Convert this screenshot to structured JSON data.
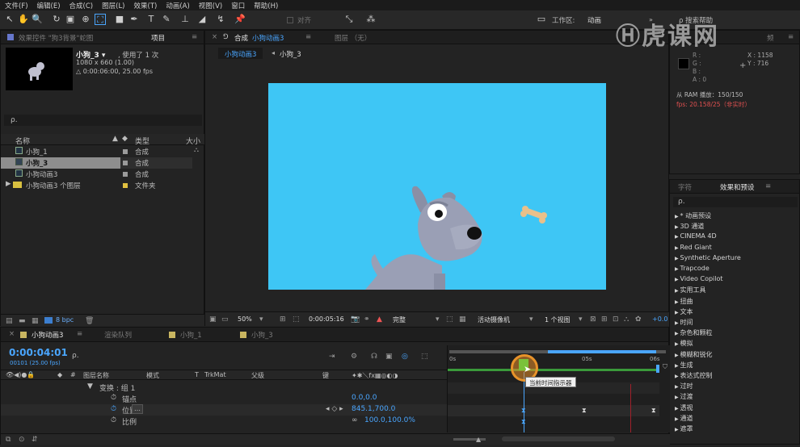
{
  "menu": [
    "文件(F)",
    "编辑(E)",
    "合成(C)",
    "图层(L)",
    "效果(T)",
    "动画(A)",
    "视图(V)",
    "窗口",
    "帮助(H)"
  ],
  "toolbar": {
    "align_label": "对齐",
    "workspace_label": "工作区:",
    "workspace_value": "动画",
    "search_help": "搜索帮助"
  },
  "project_panel": {
    "tab_effects": "效果控件 \"狗3背景\"蛇图",
    "tab_project": "项目",
    "comp_name": "小狗_3 ▾",
    "used_label": ", 使用了 1 次",
    "dimensions": "1080 x 660 (1.00)",
    "duration": "△ 0:00:06:00, 25.00 fps",
    "search_placeholder": "ρ.",
    "col_name": "名称",
    "col_type": "类型",
    "col_size": "大小",
    "items": [
      {
        "name": "小狗_1",
        "type": "合成"
      },
      {
        "name": "小狗_3",
        "type": "合成"
      },
      {
        "name": "小狗动画3",
        "type": "合成"
      },
      {
        "name": "小狗动画3 个图层",
        "type": "文件夹"
      }
    ],
    "bpc": "8 bpc"
  },
  "comp_panel": {
    "tab_comp_prefix": "合成",
    "tab_comp_name": "小狗动画3",
    "tab_layer": "图层 （无）",
    "crumb_1": "小狗动画3",
    "crumb_2": "小狗_3",
    "zoom": "50%",
    "timecode": "0:00:05:16",
    "quality": "完整",
    "camera": "活动摄像机",
    "views": "1 个视图",
    "exposure": "+0.0",
    "bg_color": "#3ec6f5"
  },
  "info_panel": {
    "r": "R :",
    "g": "G :",
    "b": "B :",
    "a": "A : 0",
    "x": "X : 1158",
    "y": "Y : 716",
    "ram": "从 RAM 播放：150/150",
    "fps": "fps: 20.158/25（非实时）",
    "tab_right": "频"
  },
  "effects_panel": {
    "tab_char": "字符",
    "tab_effects": "效果和预设",
    "search_placeholder": "ρ.",
    "items": [
      "* 动画预设",
      "3D 通道",
      "CINEMA 4D",
      "Red Giant",
      "Synthetic Aperture",
      "Trapcode",
      "Video Copilot",
      "实用工具",
      "扭曲",
      "文本",
      "时间",
      "杂色和颗粒",
      "模拟",
      "模糊和锐化",
      "生成",
      "表达式控制",
      "过时",
      "过渡",
      "透视",
      "通道",
      "遮罩"
    ]
  },
  "timeline": {
    "tab_comp": "小狗动画3",
    "tab_render": "渲染队列",
    "tab_2": "小狗_1",
    "tab_3": "小狗_3",
    "timecode": "0:00:04:01",
    "frame_info": "00101 (25.00 fps)",
    "search_placeholder": "ρ.",
    "col_layer_name": "图层名称",
    "col_mode": "模式",
    "col_t": "T",
    "col_trkmat": "TrkMat",
    "col_parent": "父级",
    "col_key": "键",
    "layers": [
      {
        "label": "变换 : 组 1",
        "value": ""
      },
      {
        "label": "锚点",
        "value": "0.0,0.0"
      },
      {
        "label": "位置",
        "value": "845.1,700.0"
      },
      {
        "label": "比例",
        "value": "100.0,100.0%"
      }
    ],
    "ruler": [
      "0s",
      "05s",
      "06s"
    ],
    "tooltip": "当前时间指示器"
  },
  "watermark": "虎课网",
  "accent": "#4aa6ff"
}
